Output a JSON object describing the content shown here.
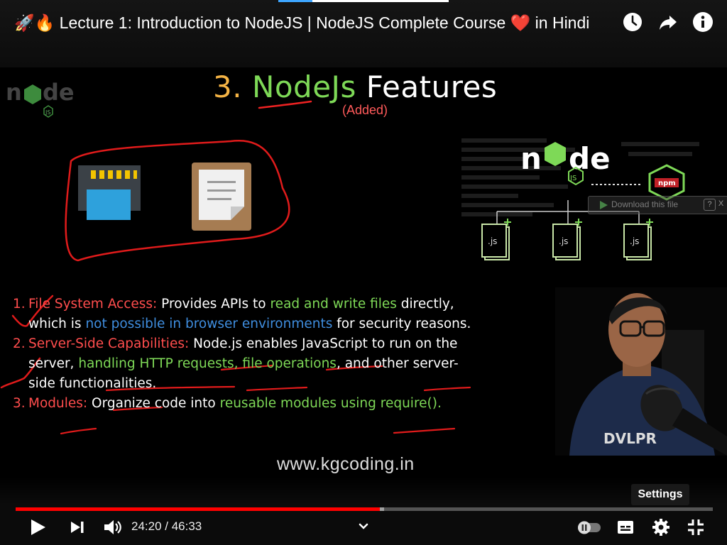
{
  "header": {
    "title": "🚀🔥 Lecture 1: Introduction to NodeJS | NodeJS Complete Course ❤️ in Hindi"
  },
  "slide": {
    "heading_num": "3.",
    "heading_node": "NodeJs",
    "heading_features": "Features",
    "subheading": "(Added)",
    "diagram": {
      "logo_text": "node",
      "npm_label": "npm",
      "file_labels": [
        ".js",
        ".js",
        ".js"
      ]
    },
    "bullets": [
      {
        "num": "1.",
        "parts": [
          {
            "t": "File System Access:",
            "c": "red"
          },
          {
            "t": " Provides APIs to ",
            "c": "white"
          },
          {
            "t": "read and write files",
            "c": "green"
          },
          {
            "t": " directly, which is ",
            "c": "white"
          },
          {
            "t": "not possible in browser environments",
            "c": "blue"
          },
          {
            "t": " for security reasons.",
            "c": "white"
          }
        ]
      },
      {
        "num": "2.",
        "parts": [
          {
            "t": "Server-Side Capabilities:",
            "c": "red"
          },
          {
            "t": " Node.js enables JavaScript to run on the server, ",
            "c": "white"
          },
          {
            "t": "handling HTTP requests, file operations",
            "c": "green"
          },
          {
            "t": ", and other server-side functionalities.",
            "c": "white"
          }
        ]
      },
      {
        "num": "3.",
        "parts": [
          {
            "t": "Modules:",
            "c": "red"
          },
          {
            "t": " Organize code into ",
            "c": "white"
          },
          {
            "t": "reusable modules using require().",
            "c": "green"
          }
        ]
      }
    ],
    "site": "www.kgcoding.in"
  },
  "overlay": {
    "download_label": "Download this file",
    "help_label": "?",
    "close_label": "X"
  },
  "player": {
    "time": "24:20 / 46:33",
    "progress": 0.5226,
    "buffered": 0.5285,
    "settings_tooltip": "Settings"
  },
  "colors": {
    "accent": "#ff0000",
    "node_green": "#7ed957",
    "heading_number": "#f5b445",
    "label_red": "#ff4d4d",
    "highlight_blue": "#3f8dde"
  },
  "icons": [
    "rocket-emoji",
    "fire-emoji",
    "heart-emoji",
    "clock-icon",
    "share-icon",
    "info-icon",
    "play-icon",
    "next-icon",
    "volume-icon",
    "chevron-down-icon",
    "autoplay-toggle-icon",
    "captions-icon",
    "gear-icon",
    "fullscreen-icon"
  ]
}
